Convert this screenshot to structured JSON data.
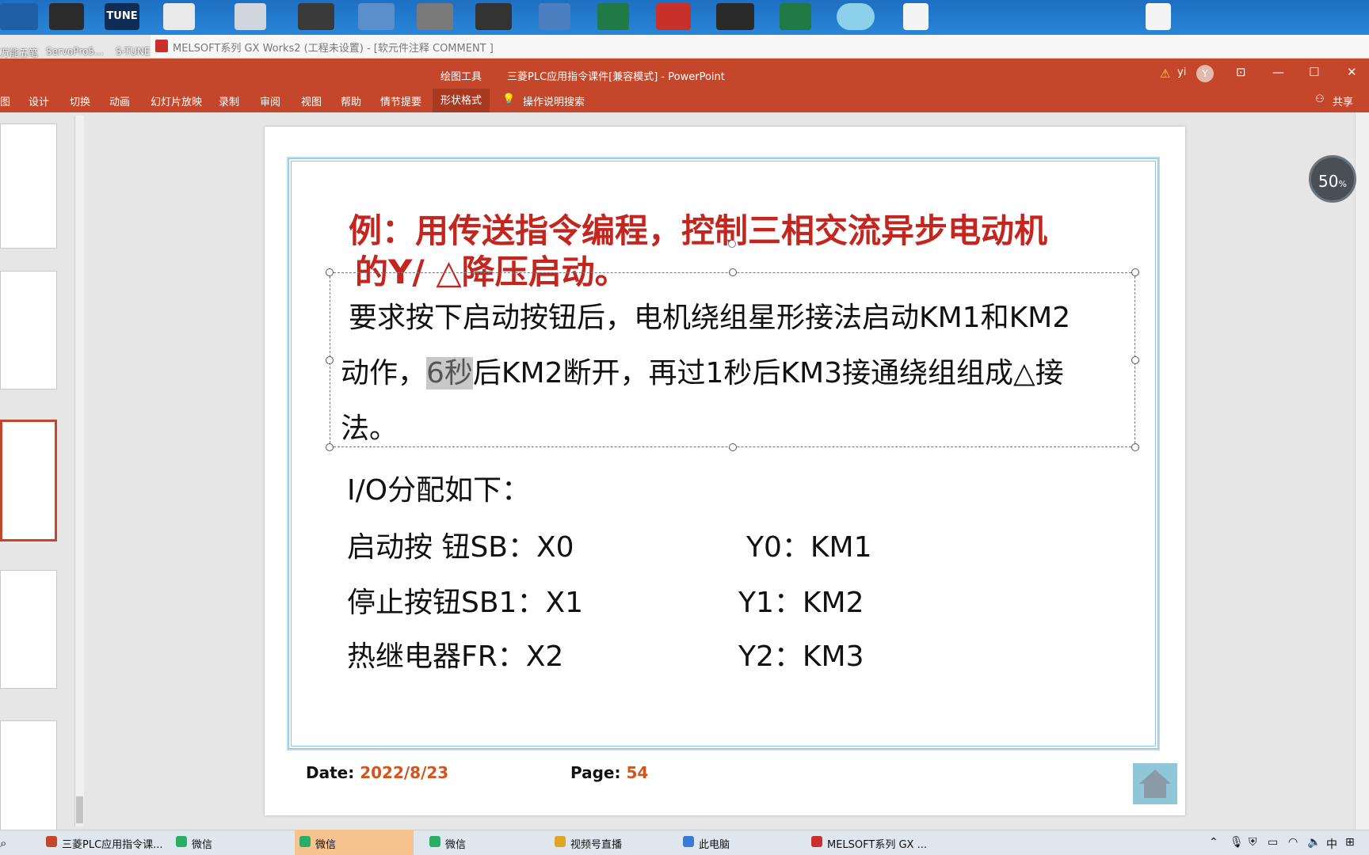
{
  "desktop": {
    "labels": [
      "万能五笔",
      "ServoPro5...",
      "S-TUNE"
    ],
    "tune_text": "TUNE"
  },
  "gx_bar": {
    "title": "MELSOFT系列 GX Works2 (工程未设置) - [软元件注释 COMMENT ]"
  },
  "ppt": {
    "tool_label": "绘图工具",
    "doc_title": "三菱PLC应用指令课件[兼容模式]  -  PowerPoint",
    "user": "yi",
    "avatar": "Y",
    "share_label": "共享",
    "tabs": [
      "图",
      "设计",
      "切换",
      "动画",
      "幻灯片放映",
      "录制",
      "审阅",
      "视图",
      "帮助",
      "情节提要",
      "形状格式"
    ],
    "search_label": "操作说明搜索"
  },
  "slide": {
    "title_line1": "例：用传送指令编程，控制三相交流异步电动机",
    "title_line2": "的Y/ △降压启动。",
    "req_line1": "要求按下启动按钮后，电机绕组星形接法启动KM1和KM2",
    "req_line2_a": "动作，",
    "req_line2_hl": "6秒",
    "req_line2_b": "后KM2断开，再过1秒后KM3接通绕组组成△接",
    "req_line3": "法。",
    "io_heading": "I/O分配如下：",
    "io_rows": [
      {
        "input": "启动按 钮SB：X0",
        "output": "Y0：KM1"
      },
      {
        "input": "停止按钮SB1：X1",
        "output": "Y1：KM2"
      },
      {
        "input": "热继电器FR：X2",
        "output": "Y2：KM3"
      }
    ],
    "date_label": "Date:",
    "date_value": "2022/8/23",
    "page_label": "Page:",
    "page_value": "54"
  },
  "zoom": {
    "value": "50",
    "unit": "%"
  },
  "taskbar": {
    "items": [
      {
        "label": "三菱PLC应用指令课...",
        "color": "#c5472b"
      },
      {
        "label": "微信",
        "color": "#2aae67"
      },
      {
        "label": "微信",
        "color": "#2aae67"
      },
      {
        "label": "微信",
        "color": "#2aae67"
      },
      {
        "label": "视频号直播",
        "color": "#e0a526"
      },
      {
        "label": "此电脑",
        "color": "#3a7bd5"
      },
      {
        "label": "MELSOFT系列 GX ...",
        "color": "#c9302c"
      }
    ],
    "tray_ime": "中"
  }
}
